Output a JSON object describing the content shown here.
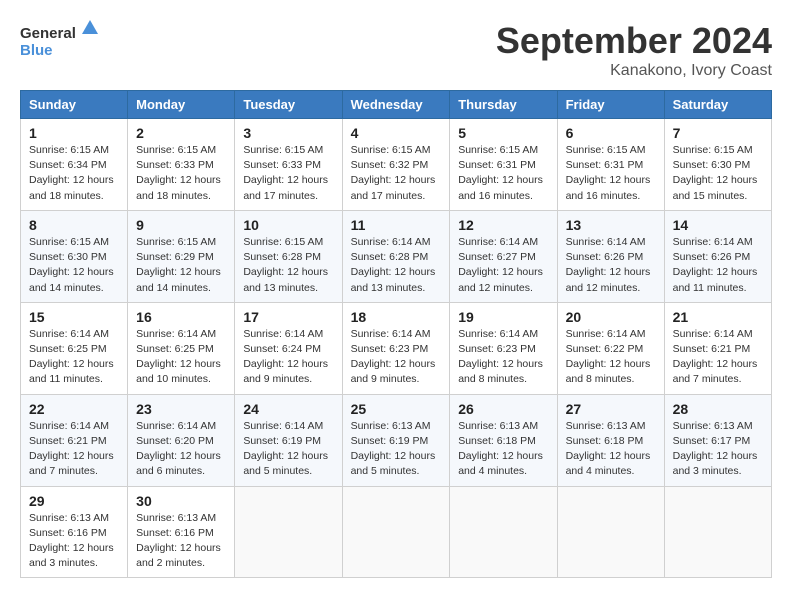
{
  "logo": {
    "general": "General",
    "blue": "Blue"
  },
  "title": "September 2024",
  "location": "Kanakono, Ivory Coast",
  "days_header": [
    "Sunday",
    "Monday",
    "Tuesday",
    "Wednesday",
    "Thursday",
    "Friday",
    "Saturday"
  ],
  "weeks": [
    [
      {
        "day": "1",
        "sunrise": "6:15 AM",
        "sunset": "6:34 PM",
        "daylight": "12 hours and 18 minutes."
      },
      {
        "day": "2",
        "sunrise": "6:15 AM",
        "sunset": "6:33 PM",
        "daylight": "12 hours and 18 minutes."
      },
      {
        "day": "3",
        "sunrise": "6:15 AM",
        "sunset": "6:33 PM",
        "daylight": "12 hours and 17 minutes."
      },
      {
        "day": "4",
        "sunrise": "6:15 AM",
        "sunset": "6:32 PM",
        "daylight": "12 hours and 17 minutes."
      },
      {
        "day": "5",
        "sunrise": "6:15 AM",
        "sunset": "6:31 PM",
        "daylight": "12 hours and 16 minutes."
      },
      {
        "day": "6",
        "sunrise": "6:15 AM",
        "sunset": "6:31 PM",
        "daylight": "12 hours and 16 minutes."
      },
      {
        "day": "7",
        "sunrise": "6:15 AM",
        "sunset": "6:30 PM",
        "daylight": "12 hours and 15 minutes."
      }
    ],
    [
      {
        "day": "8",
        "sunrise": "6:15 AM",
        "sunset": "6:30 PM",
        "daylight": "12 hours and 14 minutes."
      },
      {
        "day": "9",
        "sunrise": "6:15 AM",
        "sunset": "6:29 PM",
        "daylight": "12 hours and 14 minutes."
      },
      {
        "day": "10",
        "sunrise": "6:15 AM",
        "sunset": "6:28 PM",
        "daylight": "12 hours and 13 minutes."
      },
      {
        "day": "11",
        "sunrise": "6:14 AM",
        "sunset": "6:28 PM",
        "daylight": "12 hours and 13 minutes."
      },
      {
        "day": "12",
        "sunrise": "6:14 AM",
        "sunset": "6:27 PM",
        "daylight": "12 hours and 12 minutes."
      },
      {
        "day": "13",
        "sunrise": "6:14 AM",
        "sunset": "6:26 PM",
        "daylight": "12 hours and 12 minutes."
      },
      {
        "day": "14",
        "sunrise": "6:14 AM",
        "sunset": "6:26 PM",
        "daylight": "12 hours and 11 minutes."
      }
    ],
    [
      {
        "day": "15",
        "sunrise": "6:14 AM",
        "sunset": "6:25 PM",
        "daylight": "12 hours and 11 minutes."
      },
      {
        "day": "16",
        "sunrise": "6:14 AM",
        "sunset": "6:25 PM",
        "daylight": "12 hours and 10 minutes."
      },
      {
        "day": "17",
        "sunrise": "6:14 AM",
        "sunset": "6:24 PM",
        "daylight": "12 hours and 9 minutes."
      },
      {
        "day": "18",
        "sunrise": "6:14 AM",
        "sunset": "6:23 PM",
        "daylight": "12 hours and 9 minutes."
      },
      {
        "day": "19",
        "sunrise": "6:14 AM",
        "sunset": "6:23 PM",
        "daylight": "12 hours and 8 minutes."
      },
      {
        "day": "20",
        "sunrise": "6:14 AM",
        "sunset": "6:22 PM",
        "daylight": "12 hours and 8 minutes."
      },
      {
        "day": "21",
        "sunrise": "6:14 AM",
        "sunset": "6:21 PM",
        "daylight": "12 hours and 7 minutes."
      }
    ],
    [
      {
        "day": "22",
        "sunrise": "6:14 AM",
        "sunset": "6:21 PM",
        "daylight": "12 hours and 7 minutes."
      },
      {
        "day": "23",
        "sunrise": "6:14 AM",
        "sunset": "6:20 PM",
        "daylight": "12 hours and 6 minutes."
      },
      {
        "day": "24",
        "sunrise": "6:14 AM",
        "sunset": "6:19 PM",
        "daylight": "12 hours and 5 minutes."
      },
      {
        "day": "25",
        "sunrise": "6:13 AM",
        "sunset": "6:19 PM",
        "daylight": "12 hours and 5 minutes."
      },
      {
        "day": "26",
        "sunrise": "6:13 AM",
        "sunset": "6:18 PM",
        "daylight": "12 hours and 4 minutes."
      },
      {
        "day": "27",
        "sunrise": "6:13 AM",
        "sunset": "6:18 PM",
        "daylight": "12 hours and 4 minutes."
      },
      {
        "day": "28",
        "sunrise": "6:13 AM",
        "sunset": "6:17 PM",
        "daylight": "12 hours and 3 minutes."
      }
    ],
    [
      {
        "day": "29",
        "sunrise": "6:13 AM",
        "sunset": "6:16 PM",
        "daylight": "12 hours and 3 minutes."
      },
      {
        "day": "30",
        "sunrise": "6:13 AM",
        "sunset": "6:16 PM",
        "daylight": "12 hours and 2 minutes."
      },
      null,
      null,
      null,
      null,
      null
    ]
  ]
}
